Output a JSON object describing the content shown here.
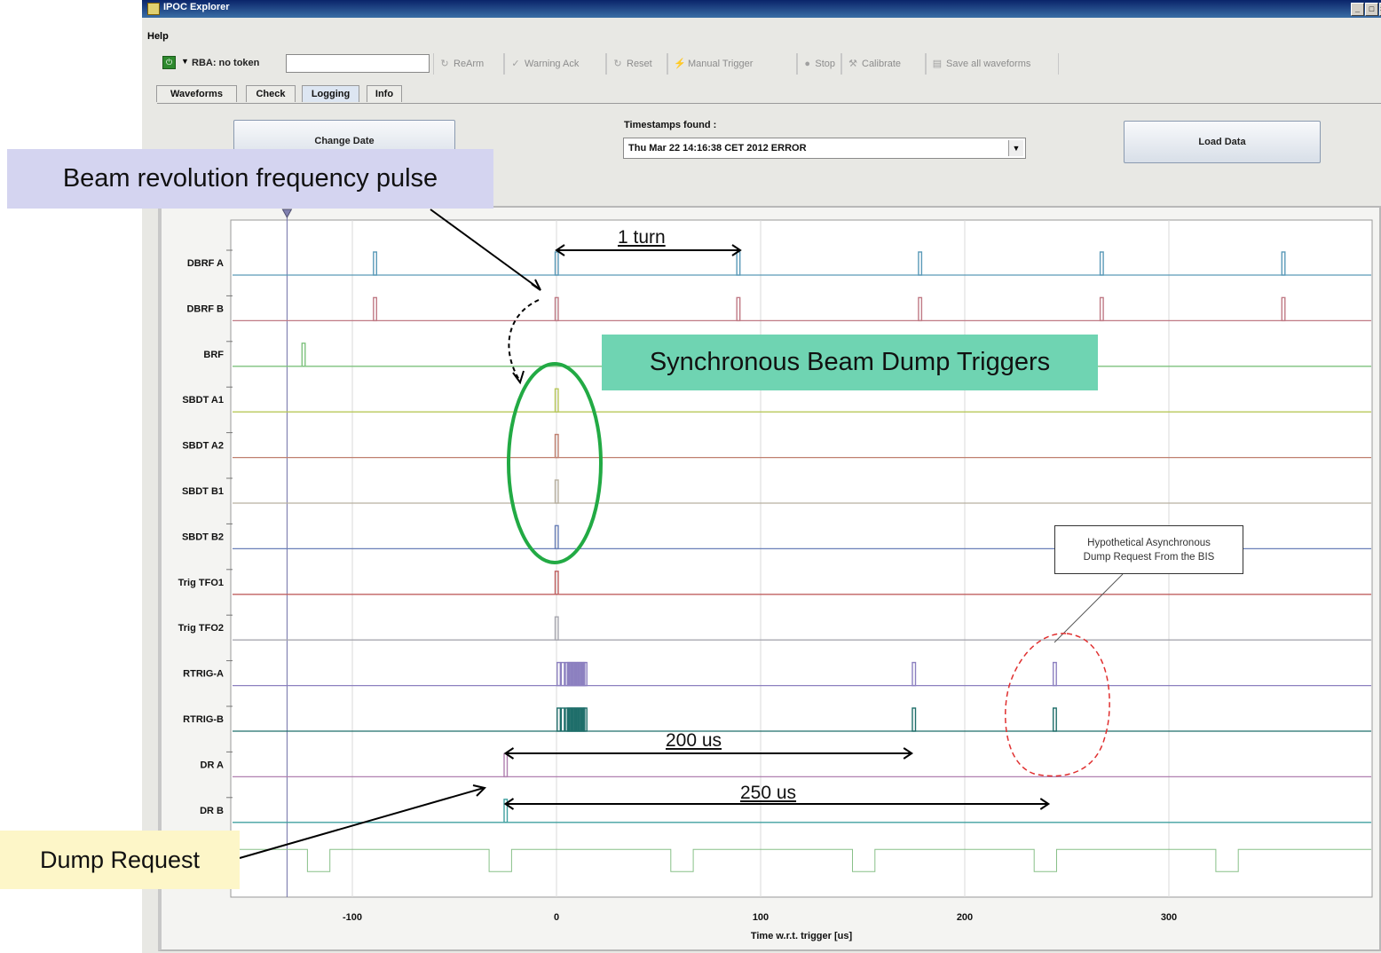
{
  "window": {
    "title": "IPOC Explorer",
    "controls": [
      "_",
      "□",
      "×"
    ]
  },
  "menu": {
    "help": "Help"
  },
  "toolbar": {
    "status_icon": "power-icon",
    "dropdown_glyph": "▼",
    "rba": "RBA: no token",
    "buttons": [
      {
        "label": "ReArm",
        "icon": "rearm-icon",
        "glyph": "↻"
      },
      {
        "label": "Warning Ack",
        "icon": "check-icon",
        "glyph": "✓"
      },
      {
        "label": "Reset",
        "icon": "reset-icon",
        "glyph": "↻"
      },
      {
        "label": "Manual Trigger",
        "icon": "lightning-icon",
        "glyph": "⚡"
      },
      {
        "label": "Stop",
        "icon": "stop-icon",
        "glyph": "●"
      },
      {
        "label": "Calibrate",
        "icon": "wrench-icon",
        "glyph": "⚒"
      },
      {
        "label": "Save all waveforms",
        "icon": "save-icon",
        "glyph": "▤"
      }
    ]
  },
  "tabs": [
    {
      "label": "Waveforms",
      "active": false
    },
    {
      "label": "Check",
      "active": false
    },
    {
      "label": "Logging",
      "active": true
    },
    {
      "label": "Info",
      "active": false
    }
  ],
  "logging": {
    "change_date": "Change Date",
    "timestamps_label": "Timestamps found :",
    "timestamp_selected": "Thu Mar 22 14:16:38 CET 2012 ERROR",
    "load_data": "Load Data"
  },
  "callouts": {
    "beam_pulse": "Beam revolution frequency pulse",
    "sync_triggers": "Synchronous Beam Dump Triggers",
    "dump_request": "Dump Request",
    "hypothetical_line1": "Hypothetical Asynchronous",
    "hypothetical_line2": "Dump Request From the BIS",
    "one_turn": "1 turn",
    "t200": "200 us",
    "t250": "250 us"
  },
  "chart_data": {
    "type": "line",
    "xlabel": "Time w.r.t. trigger [us]",
    "xlim": [
      -160,
      400
    ],
    "xticks": [
      -100,
      0,
      100,
      200,
      300
    ],
    "marker_x": -132,
    "channels": [
      {
        "name": "DBRF A",
        "color": "#5a9ab8",
        "pulses": [
          -89,
          0,
          89,
          178,
          267,
          356
        ]
      },
      {
        "name": "DBRF B",
        "color": "#c07a85",
        "pulses": [
          -89,
          0,
          89,
          178,
          267,
          356
        ]
      },
      {
        "name": "BRF",
        "color": "#7ec27e",
        "pulses": [
          -124
        ]
      },
      {
        "name": "SBDT A1",
        "color": "#b8c85a",
        "pulses": [
          0
        ]
      },
      {
        "name": "SBDT A2",
        "color": "#c08070",
        "pulses": [
          0
        ]
      },
      {
        "name": "SBDT B1",
        "color": "#b8b0a0",
        "pulses": [
          0
        ]
      },
      {
        "name": "SBDT B2",
        "color": "#6a80b8",
        "pulses": [
          0
        ]
      },
      {
        "name": "Trig TFO1",
        "color": "#c06060",
        "pulses": [
          0
        ]
      },
      {
        "name": "Trig TFO2",
        "color": "#a8a8b0",
        "pulses": [
          0
        ]
      },
      {
        "name": "RTRIG-A",
        "color": "#8c80c0",
        "pulses": [
          1,
          3,
          5,
          6,
          7,
          8,
          9,
          10,
          11,
          12,
          13,
          14,
          175,
          244
        ]
      },
      {
        "name": "RTRIG-B",
        "color": "#1f6e6a",
        "pulses": [
          1,
          3,
          5,
          6,
          7,
          8,
          9,
          10,
          11,
          12,
          13,
          14,
          175,
          244
        ]
      },
      {
        "name": "DR A",
        "color": "#b080b0",
        "pulses": [
          -25
        ]
      },
      {
        "name": "DR B",
        "color": "#40a0a0",
        "pulses": [
          -25
        ]
      },
      {
        "name": "",
        "color": "#88c088",
        "low_windows": [
          [
            -122,
            -111
          ],
          [
            -33,
            -22
          ],
          [
            56,
            67
          ],
          [
            145,
            156
          ],
          [
            234,
            245
          ],
          [
            323,
            334
          ]
        ]
      }
    ],
    "annotations": [
      {
        "label": "1 turn",
        "x1": 0,
        "x2": 90
      },
      {
        "label": "200 us",
        "x1": -25,
        "x2": 174
      },
      {
        "label": "250 us",
        "x1": -25,
        "x2": 241
      }
    ]
  }
}
